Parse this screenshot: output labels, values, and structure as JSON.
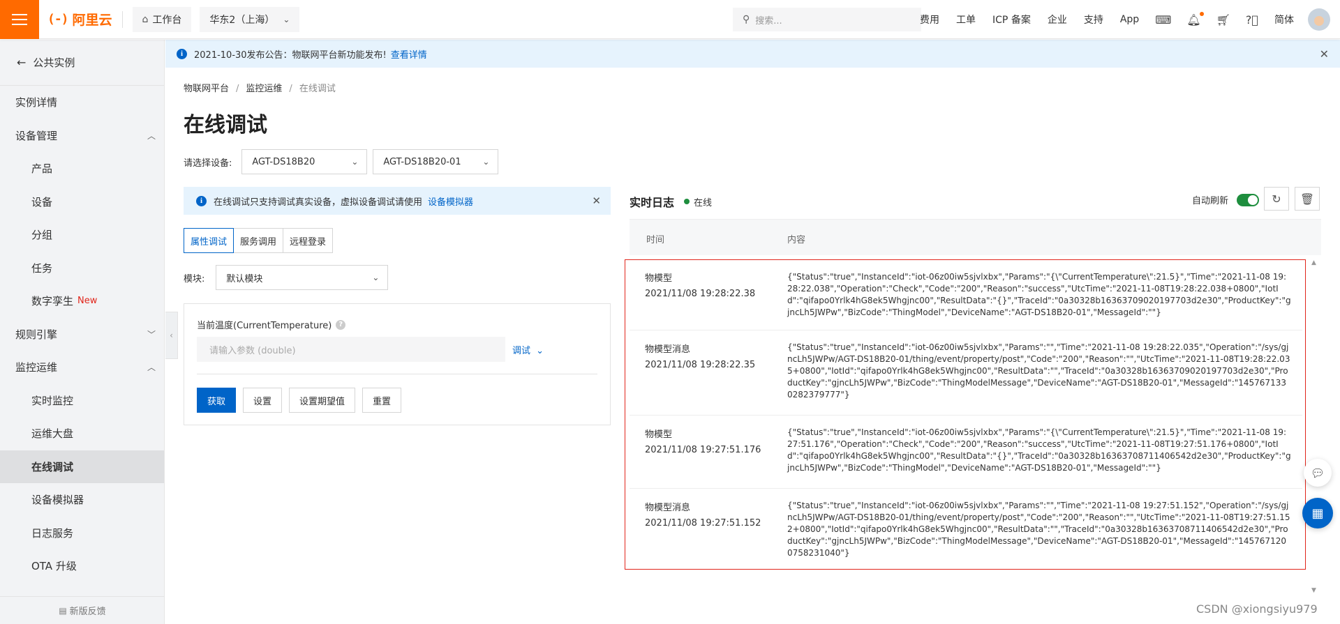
{
  "header": {
    "brand": "阿里云",
    "workbench": "工作台",
    "region": "华东2（上海）",
    "search_placeholder": "搜索...",
    "links": [
      "费用",
      "工单",
      "ICP 备案",
      "企业",
      "支持",
      "App"
    ],
    "lang": "简体"
  },
  "notice": {
    "text": "2021-10-30发布公告：物联网平台新功能发布!",
    "link": "查看详情"
  },
  "sidebar": {
    "back": "公共实例",
    "items": [
      {
        "label": "实例详情"
      },
      {
        "label": "设备管理"
      },
      {
        "label": "产品"
      },
      {
        "label": "设备"
      },
      {
        "label": "分组"
      },
      {
        "label": "任务"
      },
      {
        "label": "数字孪生",
        "tag": "New"
      },
      {
        "label": "规则引擎"
      },
      {
        "label": "监控运维"
      },
      {
        "label": "实时监控"
      },
      {
        "label": "运维大盘"
      },
      {
        "label": "在线调试"
      },
      {
        "label": "设备模拟器"
      },
      {
        "label": "日志服务"
      },
      {
        "label": "OTA 升级"
      }
    ],
    "footer": "新版反馈"
  },
  "breadcrumb": [
    "物联网平台",
    "监控运维",
    "在线调试"
  ],
  "page_title": "在线调试",
  "device_select": {
    "label": "请选择设备:",
    "product": "AGT-DS18B20",
    "device": "AGT-DS18B20-01"
  },
  "tip": {
    "text": "在线调试只支持调试真实设备，虚拟设备调试请使用",
    "link": "设备模拟器"
  },
  "tabs": [
    "属性调试",
    "服务调用",
    "远程登录"
  ],
  "module": {
    "label": "模块:",
    "value": "默认模块"
  },
  "property": {
    "label": "当前温度(CurrentTemperature)",
    "placeholder": "请输入参数 (double)",
    "debug_link": "调试",
    "buttons": [
      "获取",
      "设置",
      "设置期望值",
      "重置"
    ]
  },
  "log": {
    "title": "实时日志",
    "status": "在线",
    "auto_refresh": "自动刷新",
    "col_time": "时间",
    "col_content": "内容",
    "rows": [
      {
        "type": "物模型",
        "time": "2021/11/08 19:28:22.38",
        "content": "{\"Status\":\"true\",\"InstanceId\":\"iot-06z00iw5sjvlxbx\",\"Params\":\"{\\\"CurrentTemperature\\\":21.5}\",\"Time\":\"2021-11-08 19:28:22.038\",\"Operation\":\"Check\",\"Code\":\"200\",\"Reason\":\"success\",\"UtcTime\":\"2021-11-08T19:28:22.038+0800\",\"IotId\":\"qifapo0Yrlk4hG8ek5Whgjnc00\",\"ResultData\":\"{}\",\"TraceId\":\"0a30328b16363709020197703d2e30\",\"ProductKey\":\"gjncLh5JWPw\",\"BizCode\":\"ThingModel\",\"DeviceName\":\"AGT-DS18B20-01\",\"MessageId\":\"\"}"
      },
      {
        "type": "物模型消息",
        "time": "2021/11/08 19:28:22.35",
        "content": "{\"Status\":\"true\",\"InstanceId\":\"iot-06z00iw5sjvlxbx\",\"Params\":\"\",\"Time\":\"2021-11-08 19:28:22.035\",\"Operation\":\"/sys/gjncLh5JWPw/AGT-DS18B20-01/thing/event/property/post\",\"Code\":\"200\",\"Reason\":\"\",\"UtcTime\":\"2021-11-08T19:28:22.035+0800\",\"IotId\":\"qifapo0Yrlk4hG8ek5Whgjnc00\",\"ResultData\":\"\",\"TraceId\":\"0a30328b16363709020197703d2e30\",\"ProductKey\":\"gjncLh5JWPw\",\"BizCode\":\"ThingModelMessage\",\"DeviceName\":\"AGT-DS18B20-01\",\"MessageId\":\"1457671330282379777\"}"
      },
      {
        "type": "物模型",
        "time": "2021/11/08 19:27:51.176",
        "content": "{\"Status\":\"true\",\"InstanceId\":\"iot-06z00iw5sjvlxbx\",\"Params\":\"{\\\"CurrentTemperature\\\":21.5}\",\"Time\":\"2021-11-08 19:27:51.176\",\"Operation\":\"Check\",\"Code\":\"200\",\"Reason\":\"success\",\"UtcTime\":\"2021-11-08T19:27:51.176+0800\",\"IotId\":\"qifapo0Yrlk4hG8ek5Whgjnc00\",\"ResultData\":\"{}\",\"TraceId\":\"0a30328b16363708711406542d2e30\",\"ProductKey\":\"gjncLh5JWPw\",\"BizCode\":\"ThingModel\",\"DeviceName\":\"AGT-DS18B20-01\",\"MessageId\":\"\"}"
      },
      {
        "type": "物模型消息",
        "time": "2021/11/08 19:27:51.152",
        "content": "{\"Status\":\"true\",\"InstanceId\":\"iot-06z00iw5sjvlxbx\",\"Params\":\"\",\"Time\":\"2021-11-08 19:27:51.152\",\"Operation\":\"/sys/gjncLh5JWPw/AGT-DS18B20-01/thing/event/property/post\",\"Code\":\"200\",\"Reason\":\"\",\"UtcTime\":\"2021-11-08T19:27:51.152+0800\",\"IotId\":\"qifapo0Yrlk4hG8ek5Whgjnc00\",\"ResultData\":\"\",\"TraceId\":\"0a30328b16363708711406542d2e30\",\"ProductKey\":\"gjncLh5JWPw\",\"BizCode\":\"ThingModelMessage\",\"DeviceName\":\"AGT-DS18B20-01\",\"MessageId\":\"1457671200758231040\"}"
      }
    ]
  },
  "watermark": "CSDN @xiongsiyu979",
  "colors": {
    "brand_orange": "#ff6a00",
    "primary_blue": "#0064c8",
    "online_green": "#1e8e3e",
    "highlight_red": "#e1251b"
  },
  "icons": {
    "menu": "hamburger-icon",
    "home": "home-icon",
    "search": "search-icon",
    "terminal": "terminal-icon",
    "bell": "bell-icon",
    "cart": "cart-icon",
    "help": "help-icon",
    "info": "info-icon",
    "refresh": "refresh-icon",
    "clear": "clear-icon"
  }
}
